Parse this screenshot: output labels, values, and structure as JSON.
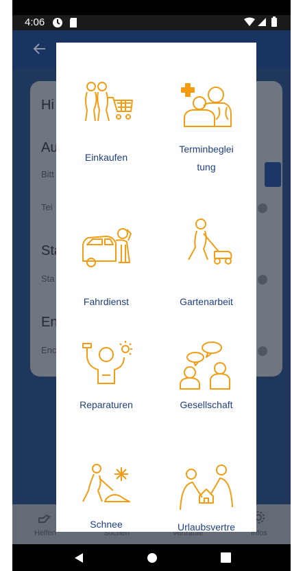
{
  "status_bar": {
    "time": "4:06"
  },
  "background": {
    "heading_1": "Hi",
    "heading_2": "Au",
    "text_1": "Bitt",
    "text_2": "Tei",
    "heading_3": "Sta",
    "text_3": "Sta",
    "heading_4": "En",
    "text_4": "Enc"
  },
  "bottom_nav": {
    "items": [
      {
        "label": "Helfen"
      },
      {
        "label": "Suchen"
      },
      {
        "label": "Vertraute"
      },
      {
        "label": "Infos"
      }
    ]
  },
  "dialog": {
    "accent_color": "#f39c12",
    "label_color": "#1e3f80",
    "tiles": [
      {
        "label_1": "Einkaufen",
        "label_2": "",
        "icon": "shopping-cart-people-icon"
      },
      {
        "label_1": "Terminbeglei",
        "label_2": "tung",
        "icon": "appointment-escort-icon"
      },
      {
        "label_1": "Fahrdienst",
        "label_2": "",
        "icon": "car-driver-icon"
      },
      {
        "label_1": "Gartenarbeit",
        "label_2": "",
        "icon": "lawnmower-icon"
      },
      {
        "label_1": "Reparaturen",
        "label_2": "",
        "icon": "repair-person-icon"
      },
      {
        "label_1": "Gesellschaft",
        "label_2": "",
        "icon": "conversation-icon"
      },
      {
        "label_1": "Schnee",
        "label_2": "",
        "icon": "snow-shovel-icon"
      },
      {
        "label_1": "Urlaubsvertre",
        "label_2": "",
        "icon": "house-handover-icon"
      }
    ]
  }
}
